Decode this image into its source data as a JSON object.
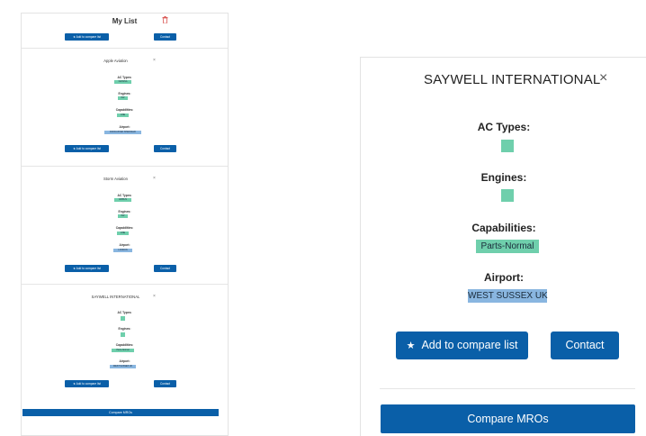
{
  "left_panel": {
    "title": "My List",
    "add_to_compare_label": "Add to compare list",
    "contact_label": "Contact",
    "compare_label": "Compare MROs",
    "labels": {
      "ac_types": "AC Types:",
      "engines": "Engines:",
      "capabilities": "Capabilities:",
      "airport": "Airport:"
    },
    "cards": [
      {
        "name": "Apple Aviation",
        "ac_type": "CESSNA",
        "engine": "PW",
        "capability": "LINE",
        "airport": "DONCASTER SHEFFIELD"
      },
      {
        "name": "Storm Aviation",
        "ac_type": "AIRBUS",
        "engine": "PW",
        "capability": "LINE",
        "airport": "LONDON"
      },
      {
        "name": "SAYWELL INTERNATIONAL",
        "ac_type": "",
        "engine": "",
        "capability": "Parts-Normal",
        "airport": "WEST SUSSEX UK"
      }
    ]
  },
  "detail": {
    "title": "SAYWELL INTERNATIONAL",
    "ac_types_label": "AC Types:",
    "engines_label": "Engines:",
    "capabilities_label": "Capabilities:",
    "capability": "Parts-Normal",
    "airport_label": "Airport:",
    "airport": "WEST SUSSEX UK",
    "add_to_compare_label": "Add to compare list",
    "contact_label": "Contact",
    "compare_label": "Compare MROs"
  },
  "colors": {
    "primary": "#0a5fa8",
    "tag_green": "#6fcfac",
    "tag_blue": "#89b6e0",
    "trash": "#d9534f"
  }
}
